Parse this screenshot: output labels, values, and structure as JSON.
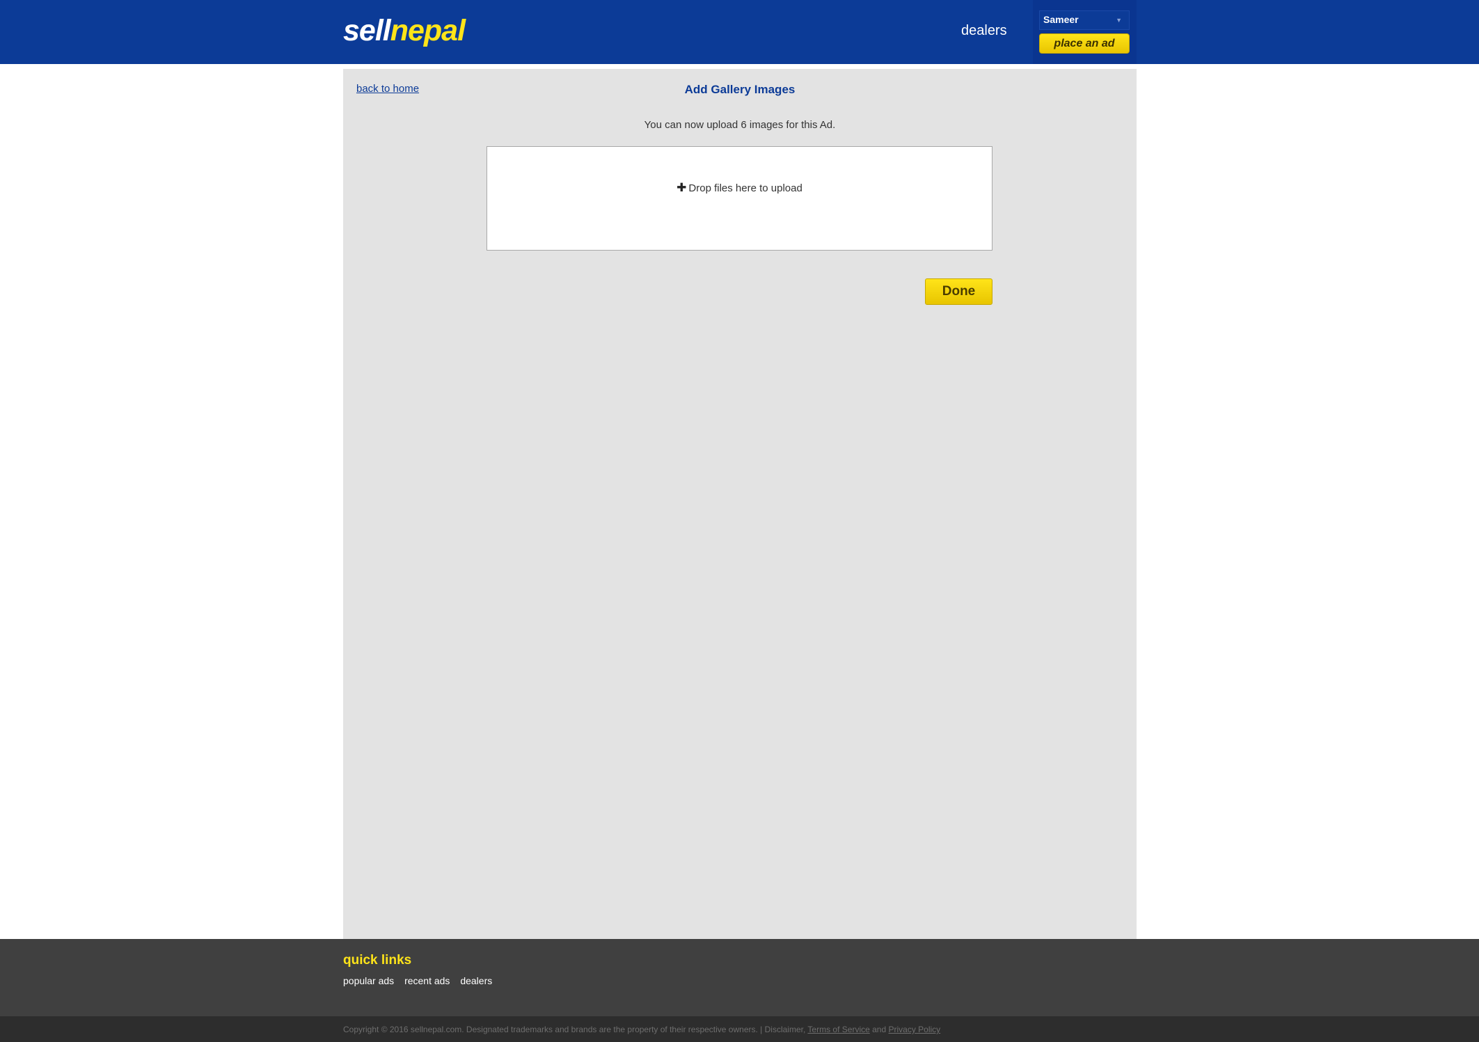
{
  "header": {
    "logo_sell": "sell",
    "logo_nepal": "nepal",
    "nav_dealers": "dealers",
    "user_name": "Sameer",
    "place_ad_label": "place an ad"
  },
  "main": {
    "back_link": "back to home",
    "title": "Add Gallery Images",
    "upload_note": "You can now upload 6 images for this Ad.",
    "dropzone_icon": "plus-icon",
    "dropzone_text": "Drop files here to upload",
    "done_label": "Done"
  },
  "footer": {
    "quick_links_title": "quick links",
    "links": [
      "popular ads",
      "recent ads",
      "dealers"
    ],
    "copyright_text": "Copyright © 2016 sellnepal.com. Designated trademarks and brands are the property of their respective owners. | Disclaimer,",
    "terms_label": "Terms of Service",
    "and_text": "and",
    "privacy_label": "Privacy Policy"
  },
  "colors": {
    "brand_blue": "#0c3b97",
    "brand_yellow": "#ffe419",
    "content_bg": "#e3e3e3",
    "footer_bg": "#404040"
  }
}
